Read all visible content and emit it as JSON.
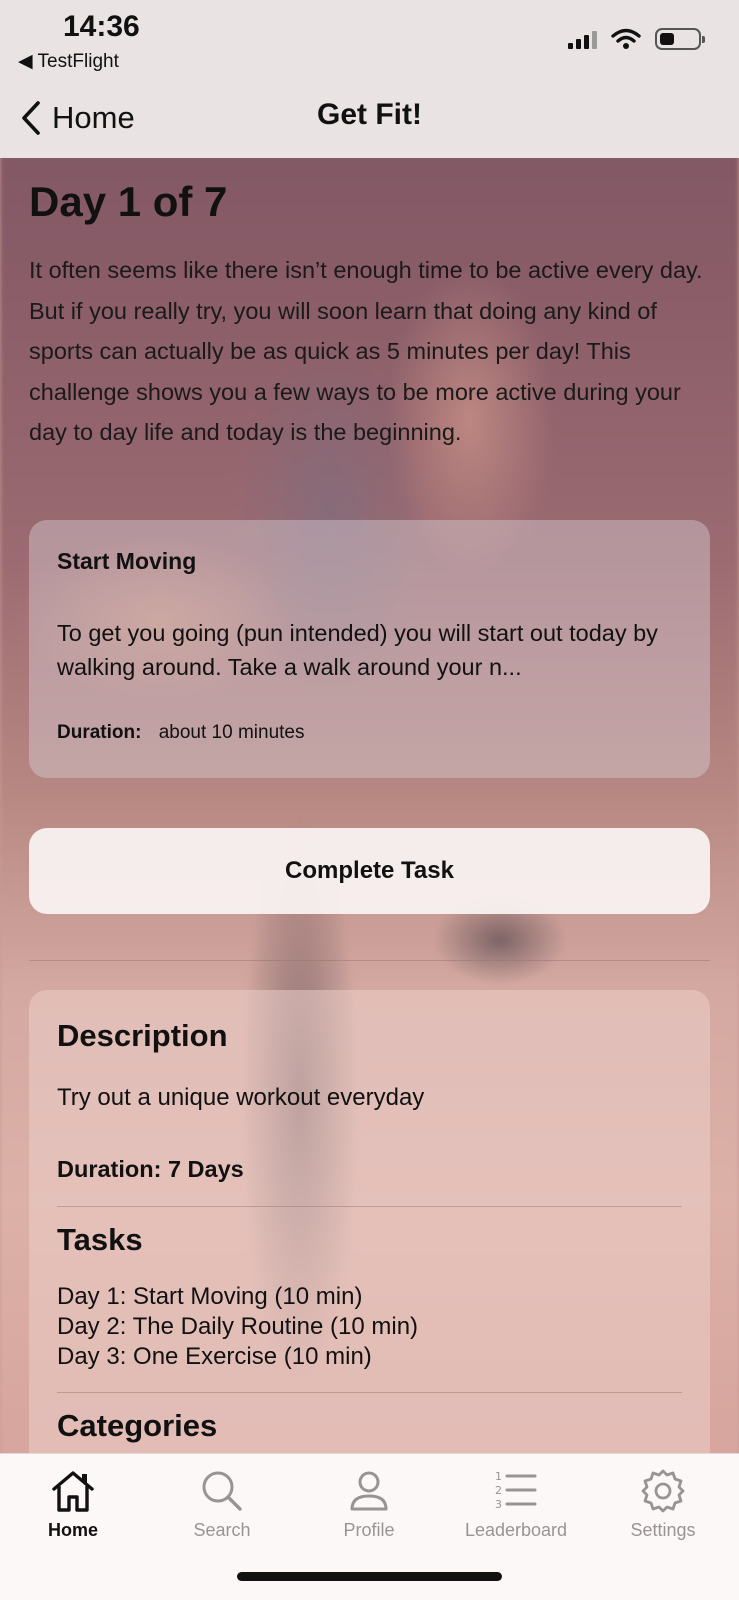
{
  "status_bar": {
    "time": "14:36",
    "back_app": "◀ TestFlight"
  },
  "nav": {
    "back_label": "Home",
    "title": "Get Fit!"
  },
  "day": {
    "title": "Day 1 of 7",
    "intro": "It often seems like there isn’t enough time to be active every day. But if you really try, you will soon learn that doing any kind of sports can actually be as quick as 5 minutes per day! This challenge shows you a few ways to be more active during your day to day life and today is the beginning."
  },
  "task": {
    "title": "Start Moving",
    "text": "To get you going (pun intended) you will start out today by walking around. Take a walk around your n...",
    "duration_label": "Duration:",
    "duration_value": "about 10 minutes"
  },
  "complete_button": "Complete Task",
  "info": {
    "description_heading": "Description",
    "description_text": "Try out a unique workout everyday",
    "duration": "Duration: 7 Days",
    "tasks_heading": "Tasks",
    "tasks": [
      "Day 1: Start Moving (10 min)",
      "Day 2: The Daily Routine (10 min)",
      "Day 3: One Exercise (10 min)"
    ],
    "categories_heading": "Categories"
  },
  "tabs": [
    {
      "label": "Home",
      "icon": "home-icon",
      "active": true
    },
    {
      "label": "Search",
      "icon": "search-icon",
      "active": false
    },
    {
      "label": "Profile",
      "icon": "profile-icon",
      "active": false
    },
    {
      "label": "Leaderboard",
      "icon": "leaderboard-icon",
      "active": false
    },
    {
      "label": "Settings",
      "icon": "settings-icon",
      "active": false
    }
  ]
}
